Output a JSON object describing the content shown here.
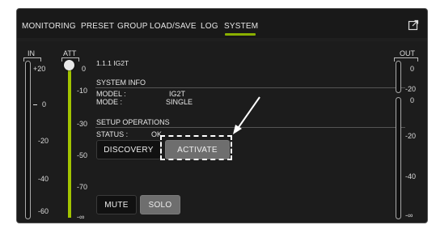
{
  "tabs": [
    {
      "label": "MONITORING",
      "active": false
    },
    {
      "label": "PRESET",
      "active": false
    },
    {
      "label": "GROUP",
      "active": false
    },
    {
      "label": "LOAD/SAVE",
      "active": false
    },
    {
      "label": "LOG",
      "active": false
    },
    {
      "label": "SYSTEM",
      "active": true
    }
  ],
  "accent_color": "#8ab000",
  "icons": {
    "popout": "popout-icon"
  },
  "meters": {
    "in_label": "IN",
    "att_label": "ATT",
    "out_label": "OUT",
    "in_scale": [
      "+20",
      "0",
      "-20",
      "-40",
      "-60"
    ],
    "att_scale": [
      "0",
      "-10",
      "-30",
      "-50",
      "-70",
      "-∞"
    ],
    "out_scale": [
      "0",
      "-20",
      "0",
      "-20",
      "-40",
      "-∞"
    ]
  },
  "device": {
    "id_line": "1.1.1  IG2T",
    "system_info_header": "SYSTEM INFO",
    "model_label": "MODEL :",
    "model_value": "IG2T",
    "mode_label": "MODE :",
    "mode_value": "SINGLE",
    "setup_header": "SETUP OPERATIONS",
    "status_label": "STATUS :",
    "status_value": "OK"
  },
  "buttons": {
    "discovery": "DISCOVERY",
    "activate": "ACTIVATE",
    "mute": "MUTE",
    "solo": "SOLO"
  }
}
